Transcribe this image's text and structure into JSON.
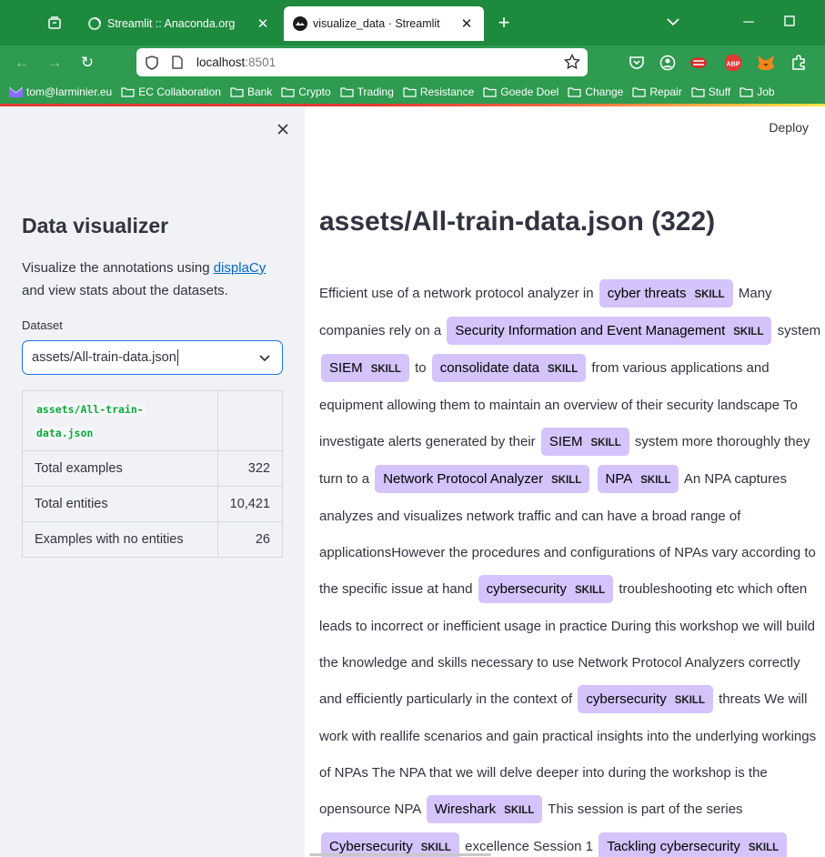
{
  "browser": {
    "tabs": [
      {
        "title": "Streamlit :: Anaconda.org",
        "active": false
      },
      {
        "title": "visualize_data · Streamlit",
        "active": true
      }
    ],
    "url_host": "localhost",
    "url_port": ":8501",
    "bookmarks": [
      "tom@larminier.eu",
      "EC Collaboration",
      "Bank",
      "Crypto",
      "Trading",
      "Resistance",
      "Goede Doel",
      "Change",
      "Repair",
      "Stuff",
      "Job"
    ],
    "colors": {
      "chrome": "#1e8a3e",
      "toolbar": "#2e9b50"
    }
  },
  "sidebar": {
    "title": "Data visualizer",
    "desc_prefix": "Visualize the annotations using ",
    "desc_link": "displaCy",
    "desc_suffix": " and view stats about the datasets.",
    "dataset_label": "Dataset",
    "dataset_value": "assets/All-train-data.json",
    "table": {
      "header_line1": "assets/All-train-",
      "header_line2": "data.json",
      "rows": [
        {
          "label": "Total examples",
          "value": "322"
        },
        {
          "label": "Total entities",
          "value": "10,421"
        },
        {
          "label": "Examples with no entities",
          "value": "26"
        }
      ]
    }
  },
  "main": {
    "deploy_label": "Deploy",
    "title": "assets/All-train-data.json (322)",
    "entity_label": "SKILL",
    "entity_color": "#d4c4fb",
    "tokens": [
      {
        "t": "Efficient use of a network protocol analyzer in "
      },
      {
        "e": "cyber threats"
      },
      {
        "t": " Many companies rely on a "
      },
      {
        "e": "Security Information and Event Management"
      },
      {
        "t": " system "
      },
      {
        "e": "SIEM"
      },
      {
        "t": " to "
      },
      {
        "e": "consolidate data"
      },
      {
        "t": " from various applications and equipment allowing them to maintain an overview of their security landscape To investigate alerts generated by their "
      },
      {
        "e": "SIEM"
      },
      {
        "t": " system more thoroughly they turn to a "
      },
      {
        "e": "Network Protocol Analyzer"
      },
      {
        "t": " "
      },
      {
        "e": "NPA"
      },
      {
        "t": " An NPA captures analyzes and visualizes network traffic and can have a broad range of applicationsHowever the procedures and configurations of NPAs vary according to the specific issue at hand "
      },
      {
        "e": "cybersecurity"
      },
      {
        "t": " troubleshooting etc which often leads to incorrect or inefficient usage in practice During this workshop we will build the knowledge and skills necessary to use Network Protocol Analyzers correctly and efficiently particularly in the context of "
      },
      {
        "e": "cybersecurity"
      },
      {
        "t": " threats We will work with reallife scenarios and gain practical insights into the underlying workings of NPAs The NPA that we will delve deeper into during the workshop is the opensource NPA "
      },
      {
        "e": "Wireshark"
      },
      {
        "t": " This session is part of the series "
      },
      {
        "e": "Cybersecurity"
      },
      {
        "t": " excellence Session 1 "
      },
      {
        "e": "Tackling cybersecurity"
      }
    ]
  }
}
